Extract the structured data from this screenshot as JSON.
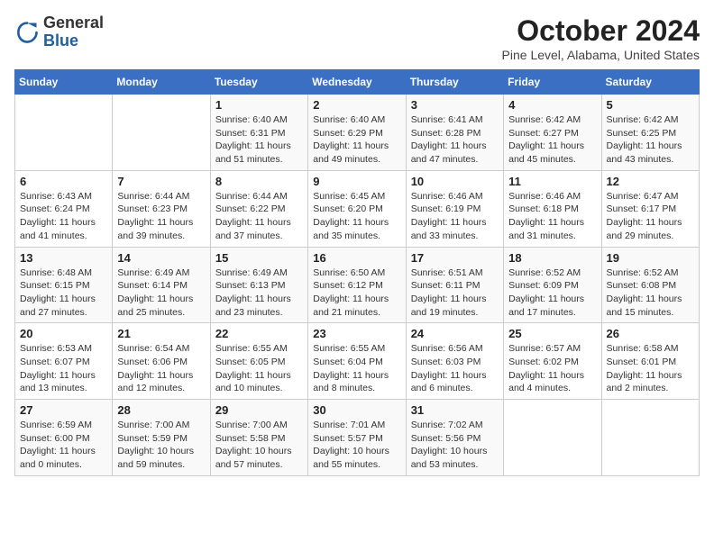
{
  "header": {
    "logo_general": "General",
    "logo_blue": "Blue",
    "month_title": "October 2024",
    "location": "Pine Level, Alabama, United States"
  },
  "days_of_week": [
    "Sunday",
    "Monday",
    "Tuesday",
    "Wednesday",
    "Thursday",
    "Friday",
    "Saturday"
  ],
  "weeks": [
    [
      null,
      null,
      {
        "day": 1,
        "sunrise": "6:40 AM",
        "sunset": "6:31 PM",
        "daylight": "11 hours and 51 minutes."
      },
      {
        "day": 2,
        "sunrise": "6:40 AM",
        "sunset": "6:29 PM",
        "daylight": "11 hours and 49 minutes."
      },
      {
        "day": 3,
        "sunrise": "6:41 AM",
        "sunset": "6:28 PM",
        "daylight": "11 hours and 47 minutes."
      },
      {
        "day": 4,
        "sunrise": "6:42 AM",
        "sunset": "6:27 PM",
        "daylight": "11 hours and 45 minutes."
      },
      {
        "day": 5,
        "sunrise": "6:42 AM",
        "sunset": "6:25 PM",
        "daylight": "11 hours and 43 minutes."
      }
    ],
    [
      {
        "day": 6,
        "sunrise": "6:43 AM",
        "sunset": "6:24 PM",
        "daylight": "11 hours and 41 minutes."
      },
      {
        "day": 7,
        "sunrise": "6:44 AM",
        "sunset": "6:23 PM",
        "daylight": "11 hours and 39 minutes."
      },
      {
        "day": 8,
        "sunrise": "6:44 AM",
        "sunset": "6:22 PM",
        "daylight": "11 hours and 37 minutes."
      },
      {
        "day": 9,
        "sunrise": "6:45 AM",
        "sunset": "6:20 PM",
        "daylight": "11 hours and 35 minutes."
      },
      {
        "day": 10,
        "sunrise": "6:46 AM",
        "sunset": "6:19 PM",
        "daylight": "11 hours and 33 minutes."
      },
      {
        "day": 11,
        "sunrise": "6:46 AM",
        "sunset": "6:18 PM",
        "daylight": "11 hours and 31 minutes."
      },
      {
        "day": 12,
        "sunrise": "6:47 AM",
        "sunset": "6:17 PM",
        "daylight": "11 hours and 29 minutes."
      }
    ],
    [
      {
        "day": 13,
        "sunrise": "6:48 AM",
        "sunset": "6:15 PM",
        "daylight": "11 hours and 27 minutes."
      },
      {
        "day": 14,
        "sunrise": "6:49 AM",
        "sunset": "6:14 PM",
        "daylight": "11 hours and 25 minutes."
      },
      {
        "day": 15,
        "sunrise": "6:49 AM",
        "sunset": "6:13 PM",
        "daylight": "11 hours and 23 minutes."
      },
      {
        "day": 16,
        "sunrise": "6:50 AM",
        "sunset": "6:12 PM",
        "daylight": "11 hours and 21 minutes."
      },
      {
        "day": 17,
        "sunrise": "6:51 AM",
        "sunset": "6:11 PM",
        "daylight": "11 hours and 19 minutes."
      },
      {
        "day": 18,
        "sunrise": "6:52 AM",
        "sunset": "6:09 PM",
        "daylight": "11 hours and 17 minutes."
      },
      {
        "day": 19,
        "sunrise": "6:52 AM",
        "sunset": "6:08 PM",
        "daylight": "11 hours and 15 minutes."
      }
    ],
    [
      {
        "day": 20,
        "sunrise": "6:53 AM",
        "sunset": "6:07 PM",
        "daylight": "11 hours and 13 minutes."
      },
      {
        "day": 21,
        "sunrise": "6:54 AM",
        "sunset": "6:06 PM",
        "daylight": "11 hours and 12 minutes."
      },
      {
        "day": 22,
        "sunrise": "6:55 AM",
        "sunset": "6:05 PM",
        "daylight": "11 hours and 10 minutes."
      },
      {
        "day": 23,
        "sunrise": "6:55 AM",
        "sunset": "6:04 PM",
        "daylight": "11 hours and 8 minutes."
      },
      {
        "day": 24,
        "sunrise": "6:56 AM",
        "sunset": "6:03 PM",
        "daylight": "11 hours and 6 minutes."
      },
      {
        "day": 25,
        "sunrise": "6:57 AM",
        "sunset": "6:02 PM",
        "daylight": "11 hours and 4 minutes."
      },
      {
        "day": 26,
        "sunrise": "6:58 AM",
        "sunset": "6:01 PM",
        "daylight": "11 hours and 2 minutes."
      }
    ],
    [
      {
        "day": 27,
        "sunrise": "6:59 AM",
        "sunset": "6:00 PM",
        "daylight": "11 hours and 0 minutes."
      },
      {
        "day": 28,
        "sunrise": "7:00 AM",
        "sunset": "5:59 PM",
        "daylight": "10 hours and 59 minutes."
      },
      {
        "day": 29,
        "sunrise": "7:00 AM",
        "sunset": "5:58 PM",
        "daylight": "10 hours and 57 minutes."
      },
      {
        "day": 30,
        "sunrise": "7:01 AM",
        "sunset": "5:57 PM",
        "daylight": "10 hours and 55 minutes."
      },
      {
        "day": 31,
        "sunrise": "7:02 AM",
        "sunset": "5:56 PM",
        "daylight": "10 hours and 53 minutes."
      },
      null,
      null
    ]
  ]
}
